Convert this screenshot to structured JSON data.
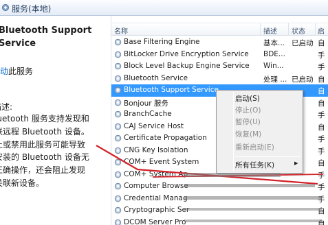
{
  "window": {
    "title": "服务(本地)"
  },
  "left_pane": {
    "service_title": "Bluetooth Support\nService",
    "start_link": "启动",
    "start_suffix": "此服务",
    "description_label": "描述:",
    "description_text": "luetooth 服务支持发现和\n联远程 Bluetooth 设备。\n止或禁用此服务可能导致\n安装的 Bluetooth 设备无\n正确操作，还会阻止发现\n关联新设备。"
  },
  "columns": {
    "name": "名称",
    "description": "描述",
    "status": "状态",
    "startup": "启"
  },
  "services": [
    {
      "name": "Base Filtering Engine",
      "description": "基本...",
      "status": "已启动",
      "startup": "自"
    },
    {
      "name": "BitLocker Drive Encryption Service",
      "description": "BDE...",
      "status": "",
      "startup": "手"
    },
    {
      "name": "Block Level Backup Engine Service",
      "description": "Win...",
      "status": "",
      "startup": "手"
    },
    {
      "name": "Bluetooth Service",
      "description": "处理 ...",
      "status": "已启动",
      "startup": "自"
    },
    {
      "name": "Bluetooth Support Service",
      "description": "",
      "status": "",
      "startup": "自"
    },
    {
      "name": "Bonjour 服务",
      "description": "",
      "status": "",
      "startup": "自"
    },
    {
      "name": "BranchCache",
      "description": "",
      "status": "",
      "startup": "手"
    },
    {
      "name": "CAJ Service Host",
      "description": "",
      "status": "",
      "startup": "自"
    },
    {
      "name": "Certificate Propagation",
      "description": "",
      "status": "",
      "startup": "手"
    },
    {
      "name": "CNG Key Isolation",
      "description": "",
      "status": "",
      "startup": "手"
    },
    {
      "name": "COM+ Event System",
      "description": "",
      "status": "",
      "startup": "自"
    },
    {
      "name": "COM+ System Ap",
      "description": "",
      "status": "",
      "startup": "手"
    },
    {
      "name": "Computer Browse",
      "description": "",
      "status": "",
      "startup": "手"
    },
    {
      "name": "Credential Manag",
      "description": "",
      "status": "",
      "startup": "手"
    },
    {
      "name": "Cryptographic Ser",
      "description": "",
      "status": "",
      "startup": "自"
    },
    {
      "name": "DCOM Server Pro",
      "description": "",
      "status": "",
      "startup": "自"
    }
  ],
  "context_menu": {
    "start": "启动(S)",
    "stop": "停止(O)",
    "pause": "暂停(U)",
    "resume": "恢复(M)",
    "restart": "重新启动(E)",
    "all_tasks": "所有任务(K)"
  },
  "colors": {
    "selection": "#3399ff",
    "annotation": "#d2232a",
    "link": "#0066cc"
  }
}
